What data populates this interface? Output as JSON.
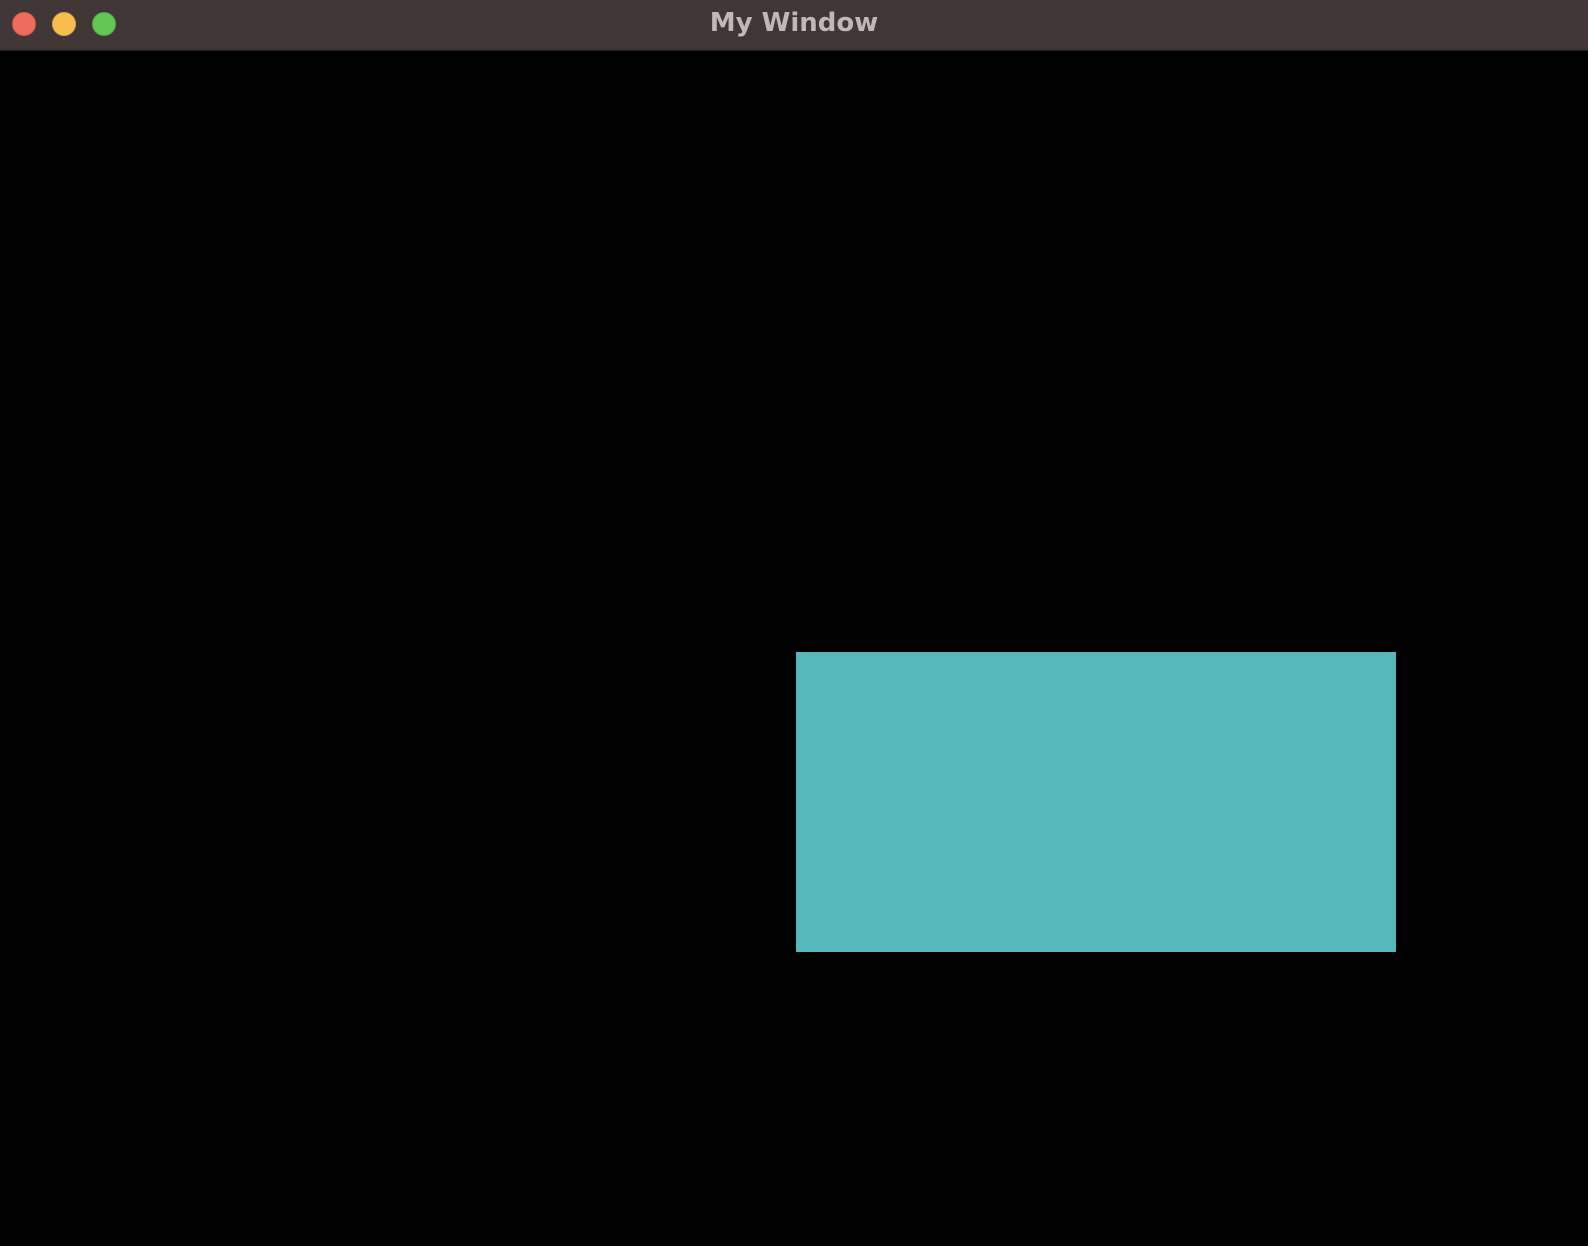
{
  "window": {
    "title": "My Window",
    "buttons": {
      "close": "close-button",
      "minimize": "minimize-button",
      "zoom": "zoom-button"
    }
  },
  "canvas": {
    "background_color": "#000000",
    "rectangle_color": "#55b9bb"
  },
  "colors": {
    "titlebar": "#3f3635",
    "title_text": "#bfb8b7",
    "close": "#ee6a5f",
    "minimize": "#f5be4f",
    "zoom": "#62c655"
  }
}
